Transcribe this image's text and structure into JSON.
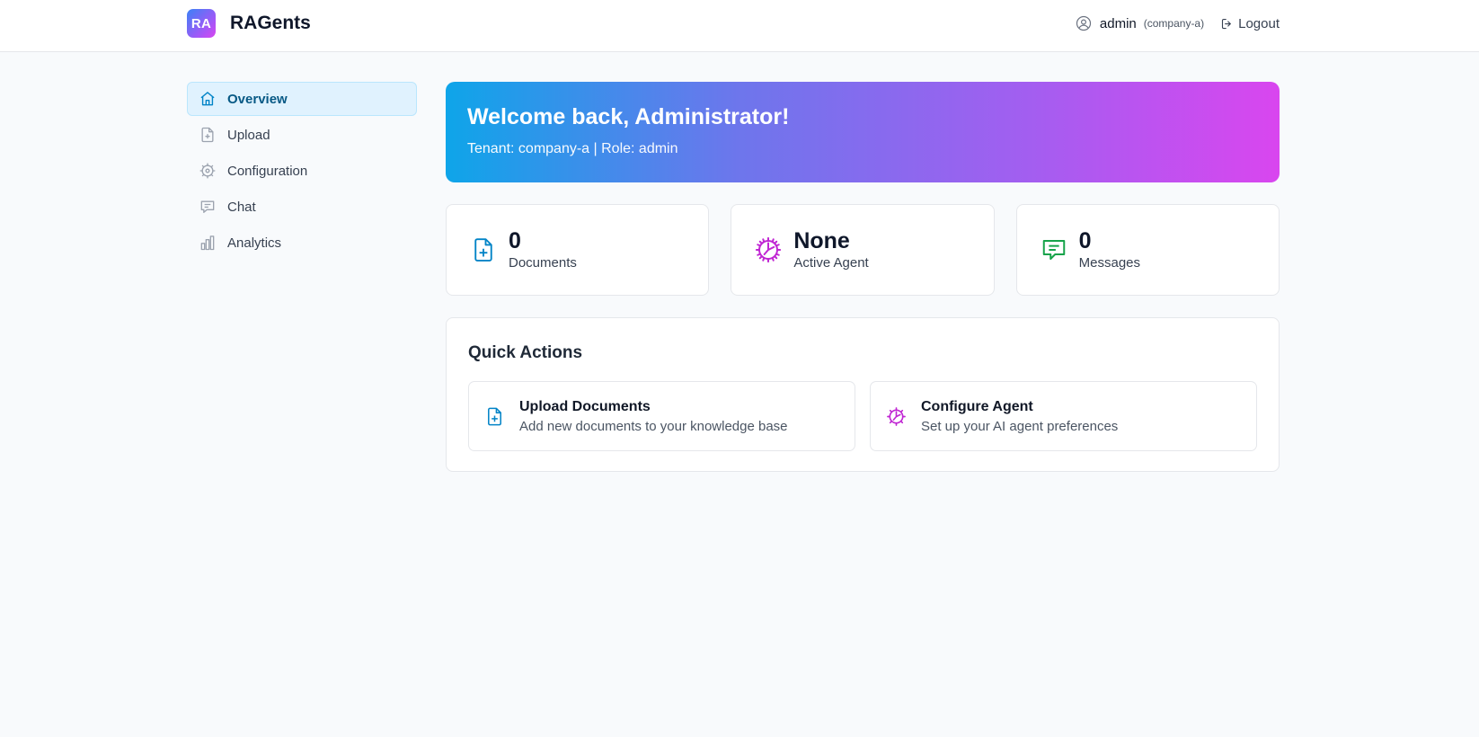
{
  "header": {
    "logo_text": "RA",
    "app_title": "RAGents",
    "username": "admin",
    "tenant": "(company-a)",
    "logout_label": "Logout"
  },
  "sidebar": {
    "items": [
      {
        "label": "Overview",
        "icon": "home-icon",
        "active": true
      },
      {
        "label": "Upload",
        "icon": "file-plus-icon",
        "active": false
      },
      {
        "label": "Configuration",
        "icon": "gear-icon",
        "active": false
      },
      {
        "label": "Chat",
        "icon": "chat-icon",
        "active": false
      },
      {
        "label": "Analytics",
        "icon": "bar-chart-icon",
        "active": false
      }
    ]
  },
  "welcome": {
    "title": "Welcome back, Administrator!",
    "subtitle": "Tenant: company-a | Role: admin"
  },
  "stats": [
    {
      "value": "0",
      "label": "Documents",
      "icon": "file-plus-icon",
      "color": "#0284c7"
    },
    {
      "value": "None",
      "label": "Active Agent",
      "icon": "gear-icon",
      "color": "#c026d3"
    },
    {
      "value": "0",
      "label": "Messages",
      "icon": "chat-icon",
      "color": "#16a34a"
    }
  ],
  "quick_actions": {
    "title": "Quick Actions",
    "items": [
      {
        "title": "Upload Documents",
        "description": "Add new documents to your knowledge base",
        "icon": "file-plus-icon",
        "color": "#0284c7"
      },
      {
        "title": "Configure Agent",
        "description": "Set up your AI agent preferences",
        "icon": "gear-icon",
        "color": "#c026d3"
      }
    ]
  },
  "colors": {
    "accent": "#0ea5e9",
    "gradient_end": "#d946ef",
    "active_nav_bg": "#e0f2fe"
  }
}
